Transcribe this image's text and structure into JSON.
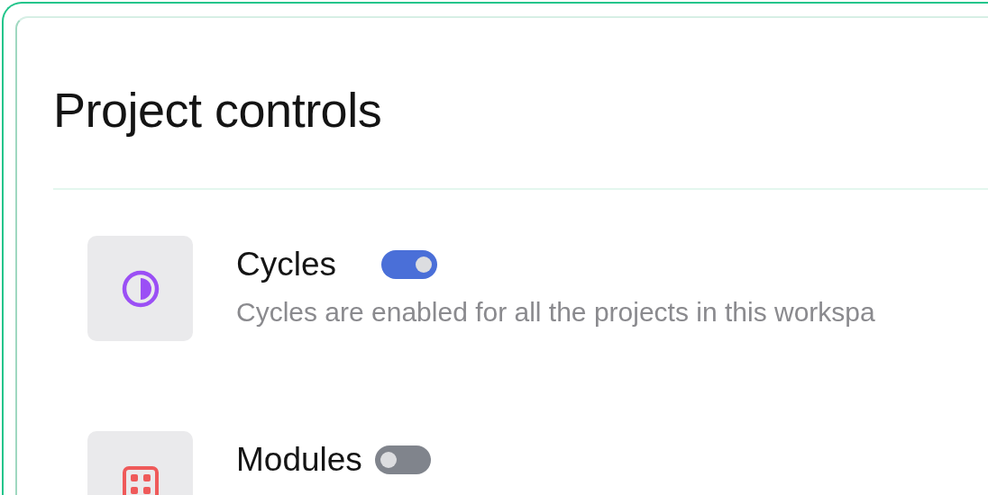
{
  "title": "Project controls",
  "features": [
    {
      "kind": "cycles",
      "name": "Cycles",
      "on": true,
      "description": "Cycles are enabled for all the projects in this workspa"
    },
    {
      "kind": "modules",
      "name": "Modules",
      "on": false
    }
  ]
}
